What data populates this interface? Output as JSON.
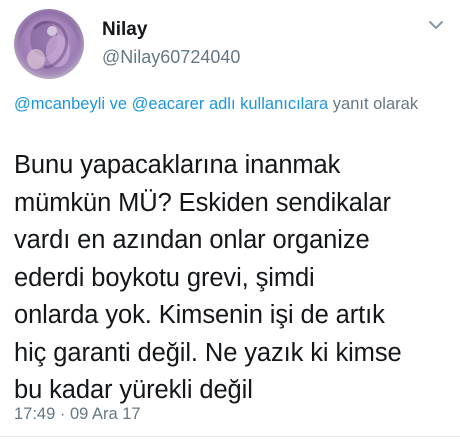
{
  "author": {
    "display_name": "Nilay",
    "handle": "@Nilay60724040",
    "avatar": "profile-photo"
  },
  "menu": {
    "icon": "chevron-down-icon"
  },
  "reply_context": {
    "mention_1": "@mcanbeyli",
    "connector": " ve ",
    "mention_2": "@eacarer",
    "mention_suffix": " adlı kullanıcılara",
    "suffix": " yanıt olarak"
  },
  "tweet": {
    "lines": [
      "Bunu yapacaklarına inanmak",
      "mümkün MÜ? Eskiden sendikalar",
      "vardı en azından onlar organize",
      "ederdi boykotu grevi, şimdi",
      "onlarda yok. Kimsenin işi de artık",
      "hiç garanti değil. Ne yazık ki kimse",
      "bu kadar yürekli değil"
    ],
    "timestamp": "17:49 · 09 Ara 17"
  },
  "colors": {
    "link": "#1b95e0",
    "secondary_text": "#657786",
    "primary_text": "#14171a"
  }
}
